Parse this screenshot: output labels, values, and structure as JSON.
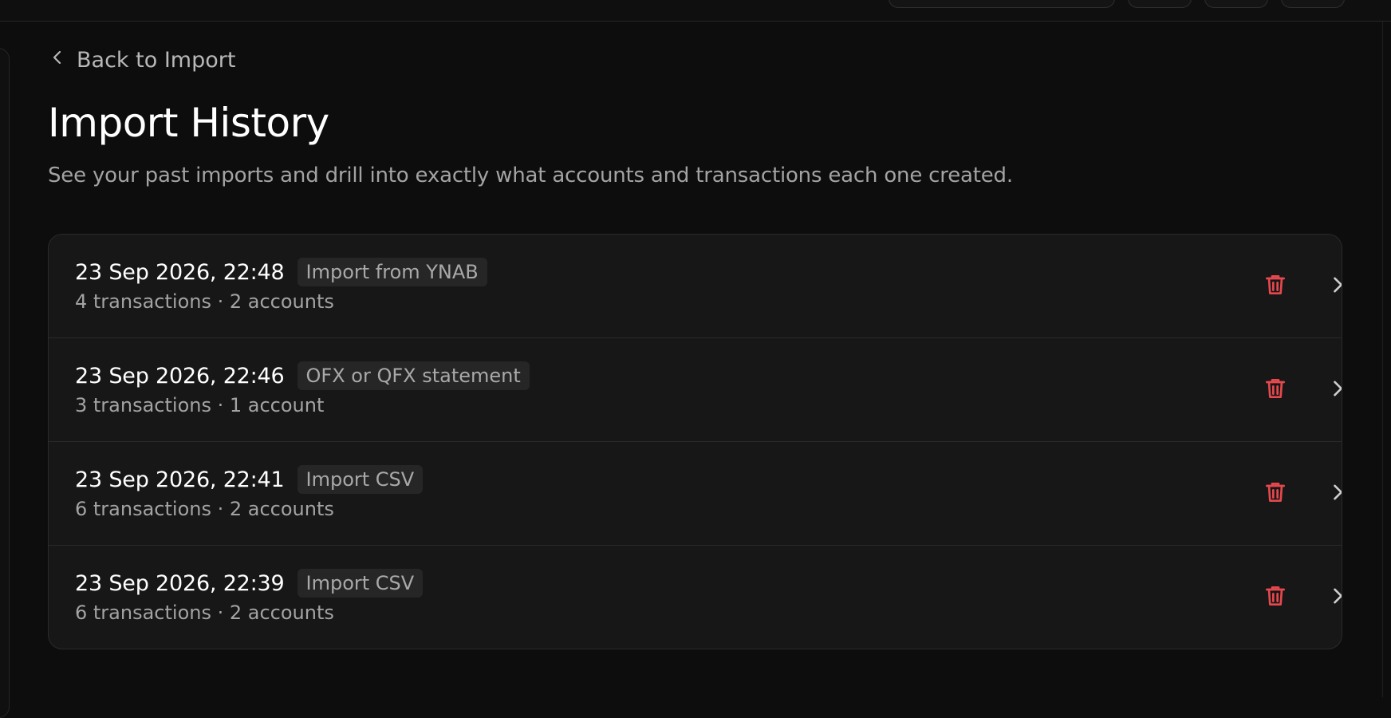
{
  "nav": {
    "back_label": "Back to Import",
    "back_icon": "chevron-left-icon"
  },
  "page": {
    "title": "Import History",
    "subtitle": "See your past imports and drill into exactly what accounts and transactions each one created."
  },
  "imports": [
    {
      "date": "23 Sep 2026, 22:48",
      "source": "Import from YNAB",
      "summary": "4 transactions · 2 accounts"
    },
    {
      "date": "23 Sep 2026, 22:46",
      "source": "OFX or QFX statement",
      "summary": "3 transactions · 1 account"
    },
    {
      "date": "23 Sep 2026, 22:41",
      "source": "Import CSV",
      "summary": "6 transactions · 2 accounts"
    },
    {
      "date": "23 Sep 2026, 22:39",
      "source": "Import CSV",
      "summary": "6 transactions · 2 accounts"
    }
  ],
  "icons": {
    "delete": "trash-icon",
    "open": "chevron-right-icon"
  },
  "colors": {
    "background": "#0d0d0d",
    "card": "#171717",
    "danger": "#e5484d",
    "text_primary": "#ffffff",
    "text_muted": "#a3a3a3"
  }
}
